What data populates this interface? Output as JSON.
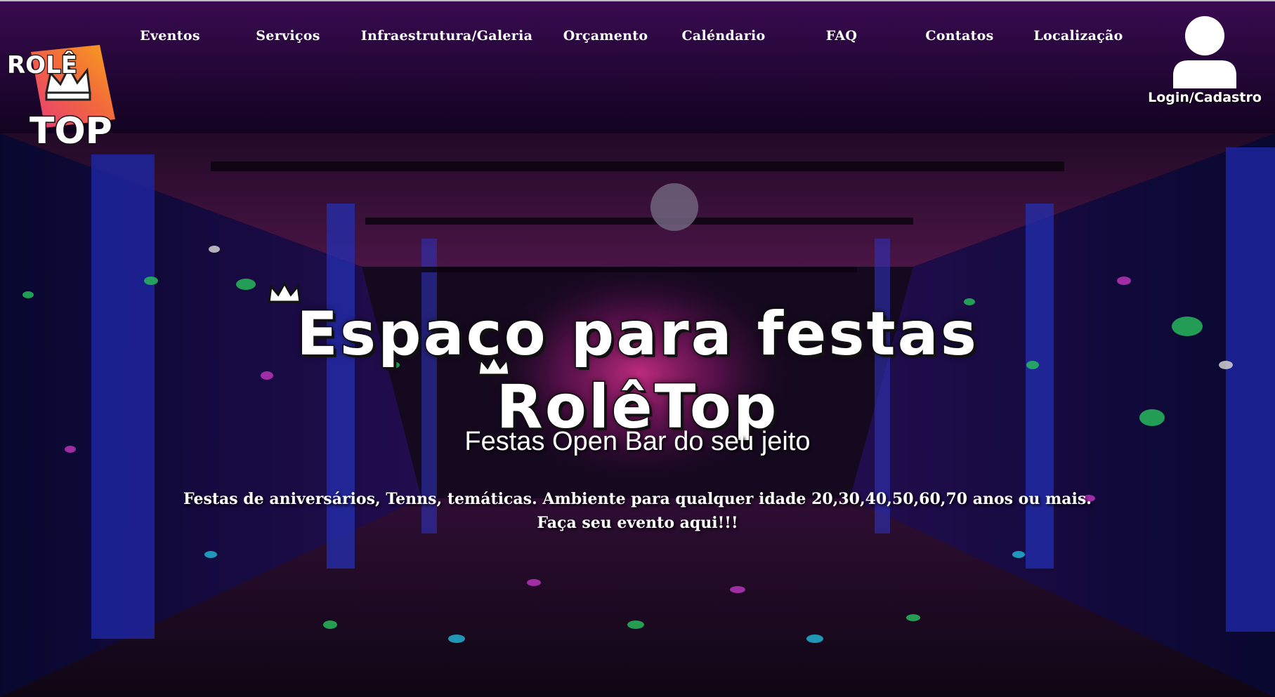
{
  "nav": {
    "items": [
      {
        "label": "Eventos"
      },
      {
        "label": "Serviços"
      },
      {
        "label": "Infraestrutura/Galeria"
      },
      {
        "label": "Orçamento"
      },
      {
        "label": "Caléndario"
      },
      {
        "label": "FAQ"
      },
      {
        "label": "Contatos"
      },
      {
        "label": "Localização"
      }
    ]
  },
  "logo": {
    "text_top": "ROLÊ",
    "text_bottom": "TOP",
    "icon": "crown-icon"
  },
  "login": {
    "label": "Login/Cadastro",
    "icon": "user-icon"
  },
  "hero": {
    "title_line1": "Espaco para festas",
    "title_line2": "RolêTop",
    "subtitle": "Festas Open Bar do seu jeito",
    "description_line1": "Festas de aniversários, Tenns, temáticas. Ambiente para qualquer idade 20,30,40,50,60,70 anos ou mais.",
    "description_line2": "Faça seu evento aqui!!!"
  },
  "colors": {
    "header_top": "#3a0a50",
    "header_bottom": "#12031f",
    "logo_orange": "#f7a21b",
    "logo_pink": "#e83a7a",
    "text": "#ffffff"
  }
}
